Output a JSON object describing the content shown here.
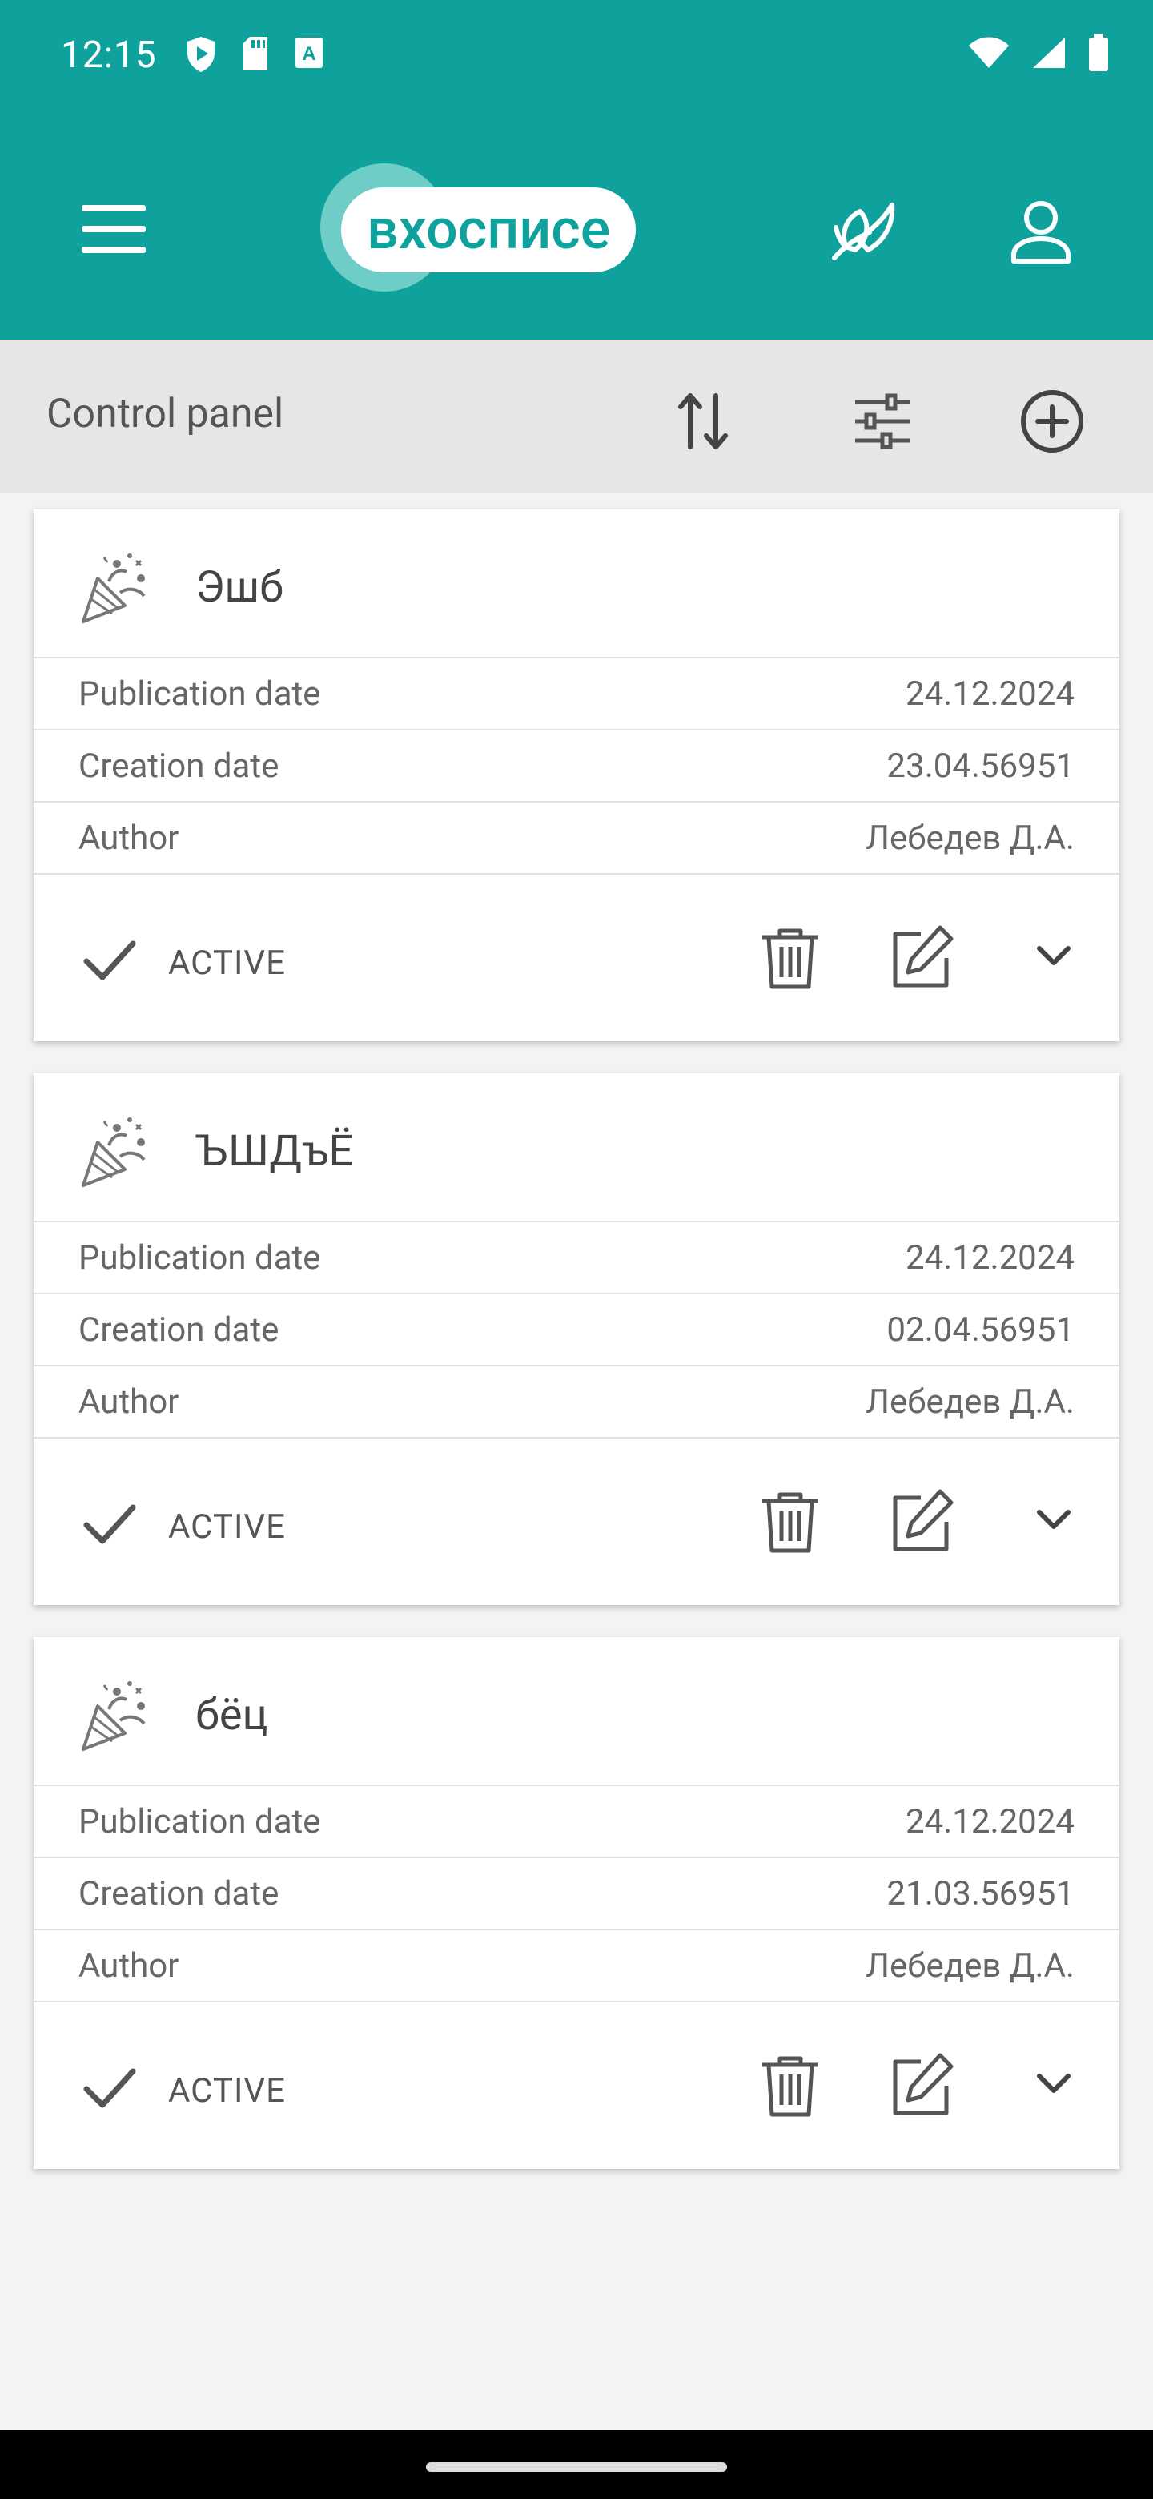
{
  "status_bar": {
    "time": "12:15",
    "left_icons": [
      "shield-play-icon",
      "sd-card-icon",
      "keyboard-a-icon"
    ],
    "right_icons": [
      "wifi-icon",
      "signal-icon",
      "battery-icon"
    ]
  },
  "app_bar": {
    "logo_text": "вхосписе",
    "menu_icon": "hamburger-menu-icon",
    "leaf_icon": "leaf-icon",
    "user_icon": "user-icon"
  },
  "control_panel": {
    "title": "Control panel",
    "sort_icon": "sort-arrows-icon",
    "filter_icon": "sliders-icon",
    "add_icon": "add-circle-icon"
  },
  "cards": [
    {
      "title": "Эшб",
      "rows": [
        {
          "label": "Publication date",
          "value": "24.12.2024"
        },
        {
          "label": "Creation date",
          "value": "23.04.56951"
        },
        {
          "label": "Author",
          "value": "Лебедев Д.А."
        }
      ],
      "status": "ACTIVE"
    },
    {
      "title": "ЪШДъЁ",
      "rows": [
        {
          "label": "Publication date",
          "value": "24.12.2024"
        },
        {
          "label": "Creation date",
          "value": "02.04.56951"
        },
        {
          "label": "Author",
          "value": "Лебедев Д.А."
        }
      ],
      "status": "ACTIVE"
    },
    {
      "title": "бёц",
      "rows": [
        {
          "label": "Publication date",
          "value": "24.12.2024"
        },
        {
          "label": "Creation date",
          "value": "21.03.56951"
        },
        {
          "label": "Author",
          "value": "Лебедев Д.А."
        }
      ],
      "status": "ACTIVE"
    }
  ],
  "colors": {
    "brand_teal": "#0fa19c",
    "control_bar": "#e6e6e6",
    "background": "#f3f3f3"
  }
}
